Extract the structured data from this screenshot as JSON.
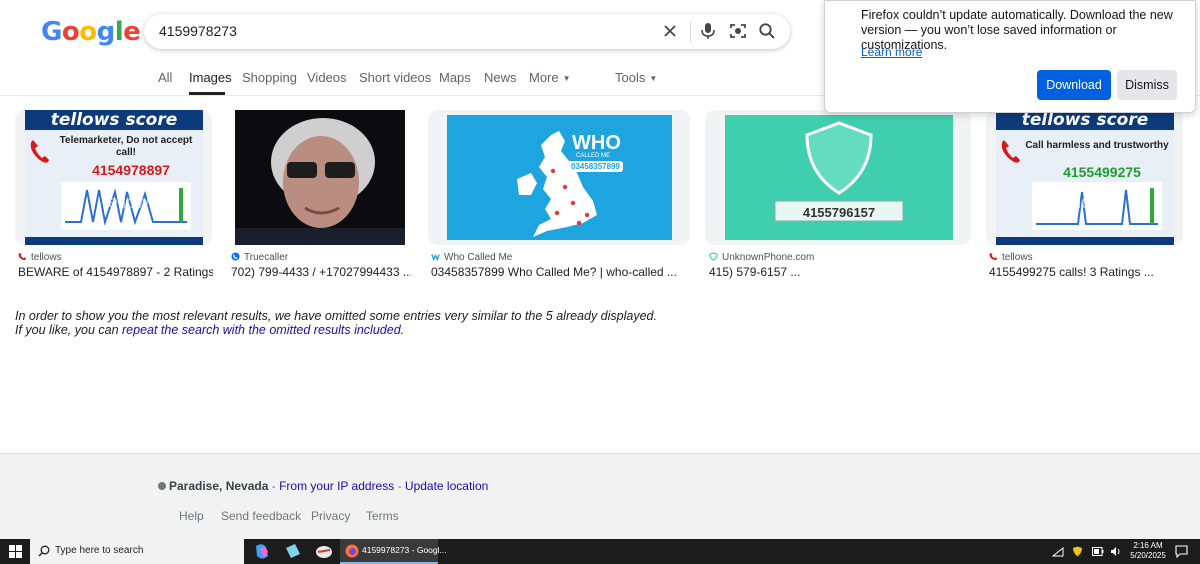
{
  "google": {
    "logo_letters": [
      {
        "ch": "G",
        "color": "#4285F4"
      },
      {
        "ch": "o",
        "color": "#EA4335"
      },
      {
        "ch": "o",
        "color": "#FBBC05"
      },
      {
        "ch": "g",
        "color": "#4285F4"
      },
      {
        "ch": "l",
        "color": "#34A853"
      },
      {
        "ch": "e",
        "color": "#EA4335"
      }
    ],
    "query": "4159978273",
    "tabs": [
      "All",
      "Images",
      "Shopping",
      "Videos",
      "Short videos",
      "Maps",
      "News",
      "More",
      "Tools"
    ],
    "active_tab": "Images"
  },
  "results": [
    {
      "source": "tellows",
      "title": "BEWARE of 4154978897 - 2 Ratings",
      "banner": "tellows score",
      "line": "Telemarketer, Do not accept call!",
      "number": "4154978897",
      "watermark": "tellows"
    },
    {
      "source": "Truecaller",
      "title": "702) 799-4433 / +17027994433 ..."
    },
    {
      "source": "Who Called Me",
      "title": "03458357899 Who Called Me? | who-called ...",
      "brand": "WHO",
      "sub": "CALLED ME",
      "number": "03458357899"
    },
    {
      "source": "UnknownPhone.com",
      "title": "415) 579-6157 ...",
      "number": "4155796157"
    },
    {
      "source": "tellows",
      "title": "4155499275 calls! 3 Ratings ...",
      "banner": "tellows score",
      "line": "Call harmless and trustworthy",
      "number": "4155499275",
      "watermark": "tellows"
    }
  ],
  "notice": {
    "line1": "In order to show you the most relevant results, we have omitted some entries very similar to the 5 already displayed.",
    "line2_prefix": "If you like, you can ",
    "line2_link": "repeat the search with the omitted results included",
    "line2_suffix": "."
  },
  "footer": {
    "location": "Paradise, Nevada",
    "sep": " - ",
    "ip_link": "From your IP address",
    "update_link": "Update location",
    "links": [
      "Help",
      "Send feedback",
      "Privacy",
      "Terms"
    ]
  },
  "firefox_popup": {
    "message": "Firefox couldn’t update automatically. Download the new version — you won’t lose saved information or customizations.",
    "learn_more": "Learn more",
    "download": "Download",
    "dismiss": "Dismiss"
  },
  "taskbar": {
    "search_placeholder": "Type here to search",
    "firefox_window": "4159978273 - Googl...",
    "time": "2:16 AM",
    "date": "5/20/2025"
  },
  "colors": {
    "link": "#1a0dab",
    "firefox_blue": "#0061e0",
    "tellows_navy": "#0d3a7a",
    "tellows_red": "#d41a1a"
  }
}
